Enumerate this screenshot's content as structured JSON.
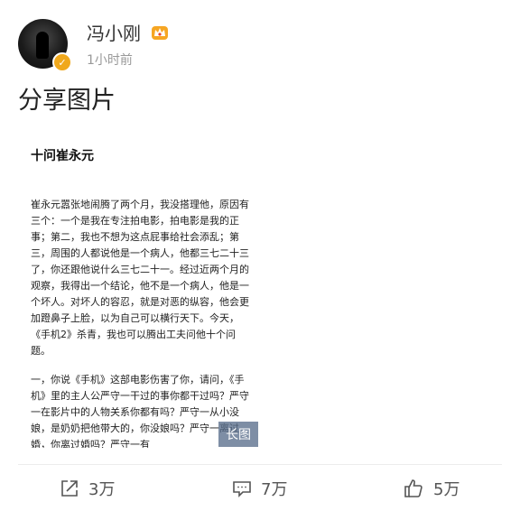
{
  "post": {
    "author": "冯小刚",
    "time": "1小时前",
    "title": "分享图片"
  },
  "image": {
    "doc_title": "十问崔永元",
    "para1": "崔永元嚣张地闹腾了两个月，我没搭理他，原因有三个：一个是我在专注拍电影，拍电影是我的正事；第二，我也不想为这点屁事给社会添乱；第三，周围的人都说他是一个病人，他都三七二十三了，你还跟他说什么三七二十一。经过近两个月的观察，我得出一个结论，他不是一个病人，他是一个坏人。对坏人的容忍，就是对恶的纵容，他会更加蹬鼻子上脸，以为自己可以横行天下。今天，《手机2》杀青，我也可以腾出工夫问他十个问题。",
    "para2": "一，你说《手机》这部电影伤害了你，请问，《手机》里的主人公严守一干过的事你都干过吗？严守一在影片中的人物关系你都有吗？严守一从小没娘，是奶奶把他带大的，你没娘吗？严守一离过婚，你离过婚吗？严守一有",
    "long_badge": "长图"
  },
  "actions": {
    "share_count": "3万",
    "comment_count": "7万",
    "like_count": "5万"
  },
  "colors": {
    "verified": "#f0a81c",
    "badge_bg": "#5a6e8c"
  }
}
